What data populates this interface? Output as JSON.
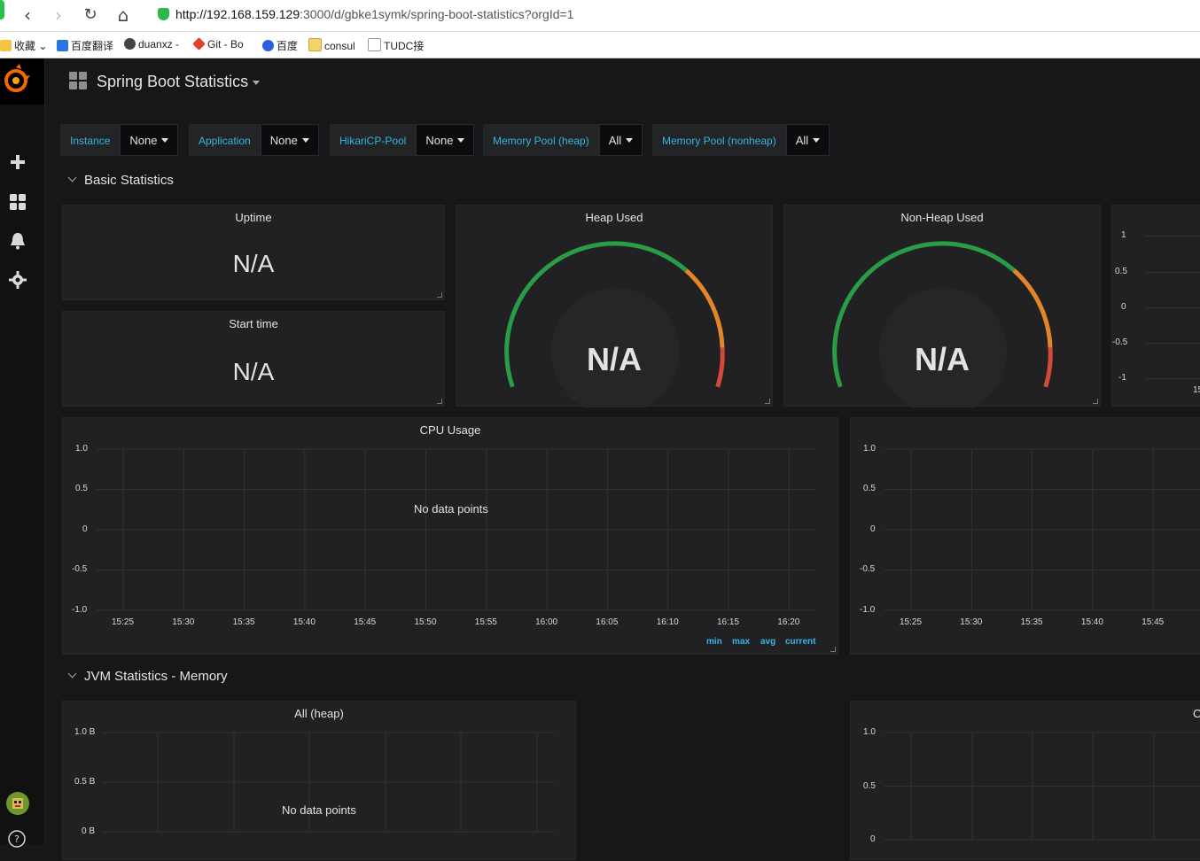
{
  "browser": {
    "url_host": "http://192.168.159.129",
    "url_rest": ":3000/d/gbke1symk/spring-boot-statistics?orgId=1",
    "bookmarks": [
      "收藏",
      "百度翻译",
      "duanxz -",
      "Git - Bo",
      "百度",
      "consul",
      "TUDC接"
    ]
  },
  "dashboard": {
    "title": "Spring Boot Statistics"
  },
  "variables": [
    {
      "label": "Instance",
      "value": "None"
    },
    {
      "label": "Application",
      "value": "None"
    },
    {
      "label": "HikariCP-Pool",
      "value": "None"
    },
    {
      "label": "Memory Pool (heap)",
      "value": "All"
    },
    {
      "label": "Memory Pool (nonheap)",
      "value": "All"
    }
  ],
  "rows": {
    "basic": "Basic Statistics",
    "jvm_memory": "JVM Statistics - Memory"
  },
  "panels": {
    "uptime": {
      "title": "Uptime",
      "value": "N/A"
    },
    "start_time": {
      "title": "Start time",
      "value": "N/A"
    },
    "heap_used": {
      "title": "Heap Used",
      "value": "N/A"
    },
    "nonheap_used": {
      "title": "Non-Heap Used",
      "value": "N/A"
    },
    "cpu_usage": {
      "title": "CPU Usage",
      "no_data": "No data points",
      "legend": [
        "min",
        "max",
        "avg",
        "current"
      ]
    },
    "all_heap": {
      "title": "All (heap)",
      "no_data": "No data points"
    },
    "partial_right_title": "C"
  },
  "axes": {
    "y_small": [
      "1",
      "0.5",
      "0",
      "-0.5",
      "-1"
    ],
    "y_cpu": [
      "1.0",
      "0.5",
      "0",
      "-0.5",
      "-1.0"
    ],
    "x_cpu": [
      "15:25",
      "15:30",
      "15:35",
      "15:40",
      "15:45",
      "15:50",
      "15:55",
      "16:00",
      "16:05",
      "16:10",
      "16:15",
      "16:20"
    ],
    "x_right": [
      "15:25",
      "15:30",
      "15:35",
      "15:40",
      "15:45"
    ],
    "x_small_partial": "15",
    "y_heap": [
      "1.0 B",
      "0.5 B",
      "0 B"
    ],
    "y_right_bottom": [
      "1.0",
      "0.5",
      "0"
    ]
  },
  "colors": {
    "accent": "#33b5e5",
    "gauge_green": "#299c46",
    "gauge_orange": "#e5852a",
    "gauge_red": "#d44a3a"
  }
}
